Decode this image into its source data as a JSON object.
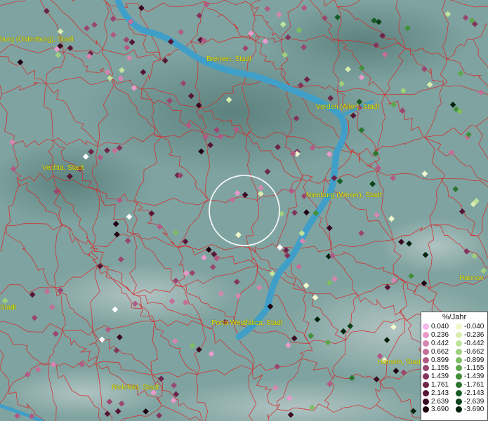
{
  "map": {
    "cities": [
      {
        "name": "burg (Oldenburg), Stadt"
      },
      {
        "name": "Bremen, Stadt"
      },
      {
        "name": "Verden (Aller), Stadt"
      },
      {
        "name": "Vechta, Stadt"
      },
      {
        "name": "Nienburg (Weser), Stadt"
      },
      {
        "name": "Hannov"
      },
      {
        "name": "Stadt"
      },
      {
        "name": "Porta Westfalica, Stadt"
      },
      {
        "name": "Hameln, Stadt"
      },
      {
        "name": "Bielefeld, Stadt"
      }
    ],
    "colors": {
      "background": "#7fa3a0",
      "river": "#3f9fc8",
      "borders": "#d42a2a",
      "city_labels": "#e6e600"
    }
  },
  "legend": {
    "title": "%/Jahr",
    "positive": [
      {
        "label": "0.040",
        "color": "#f7b8ee"
      },
      {
        "label": "0.236",
        "color": "#e89acb"
      },
      {
        "label": "0.442",
        "color": "#d586b0"
      },
      {
        "label": "0.662",
        "color": "#c46e98"
      },
      {
        "label": "0.899",
        "color": "#b05a84"
      },
      {
        "label": "1.155",
        "color": "#9a4670"
      },
      {
        "label": "1.439",
        "color": "#82345c"
      },
      {
        "label": "1.761",
        "color": "#6c2448"
      },
      {
        "label": "2.143",
        "color": "#561636"
      },
      {
        "label": "2.639",
        "color": "#3a0a22"
      },
      {
        "label": "3.690",
        "color": "#1f0010"
      }
    ],
    "negative": [
      {
        "label": "-0.040",
        "color": "#f2f8cc"
      },
      {
        "label": "-0.236",
        "color": "#d8edaf"
      },
      {
        "label": "-0.442",
        "color": "#bfe39a"
      },
      {
        "label": "-0.662",
        "color": "#9fd07e"
      },
      {
        "label": "-0.899",
        "color": "#7fbd63"
      },
      {
        "label": "-1.155",
        "color": "#5ea64a"
      },
      {
        "label": "-1.439",
        "color": "#428f3a"
      },
      {
        "label": "-1.761",
        "color": "#2a7530"
      },
      {
        "label": "-2.143",
        "color": "#175d26"
      },
      {
        "label": "-2.639",
        "color": "#0a4219"
      },
      {
        "label": "-3.690",
        "color": "#02240c"
      }
    ]
  }
}
